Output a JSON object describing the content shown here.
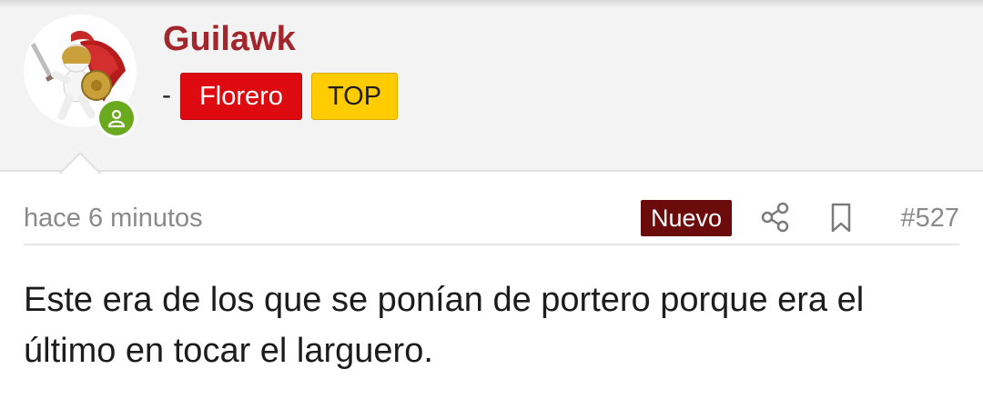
{
  "user": {
    "name": "Guilawk",
    "separator": "-",
    "badges": [
      {
        "label": "Florero",
        "color": "#dd0a10"
      },
      {
        "label": "TOP",
        "color": "#ffcc00"
      }
    ],
    "online": true,
    "avatar_icon": "spartan-warrior-avatar"
  },
  "post": {
    "time": "hace 6 minutos",
    "new_label": "Nuevo",
    "number": "#527",
    "share_icon": "share-icon",
    "bookmark_icon": "bookmark-icon",
    "body": "Este era de los que se ponían de portero porque era el último en tocar el larguero."
  },
  "colors": {
    "username": "#a3262d",
    "online": "#6aaa1e",
    "new_badge": "#6b0b0b"
  }
}
